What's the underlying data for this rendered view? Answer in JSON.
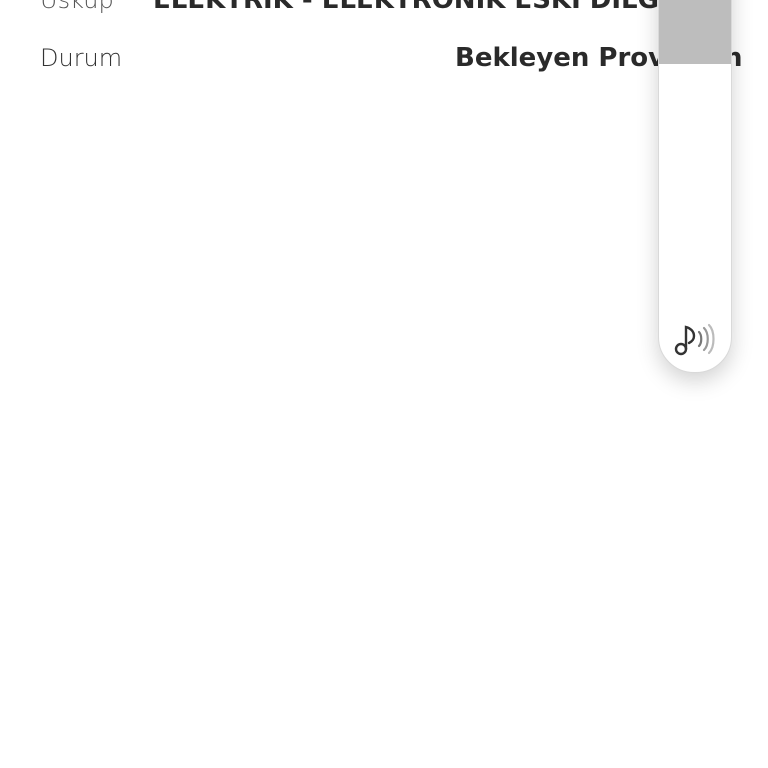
{
  "details": {
    "top_row": {
      "label": "Üsküp",
      "value": "ELEKTRİK - ELEKTRONİK ESKİ DİLGİSİ"
    },
    "status_row": {
      "label": "Durum",
      "value": "Bekleyen Provizyon"
    }
  },
  "volume_overlay": {
    "level": 0.25,
    "fill_color": "#bdbdbd",
    "icon": "music-note-volume-icon"
  }
}
